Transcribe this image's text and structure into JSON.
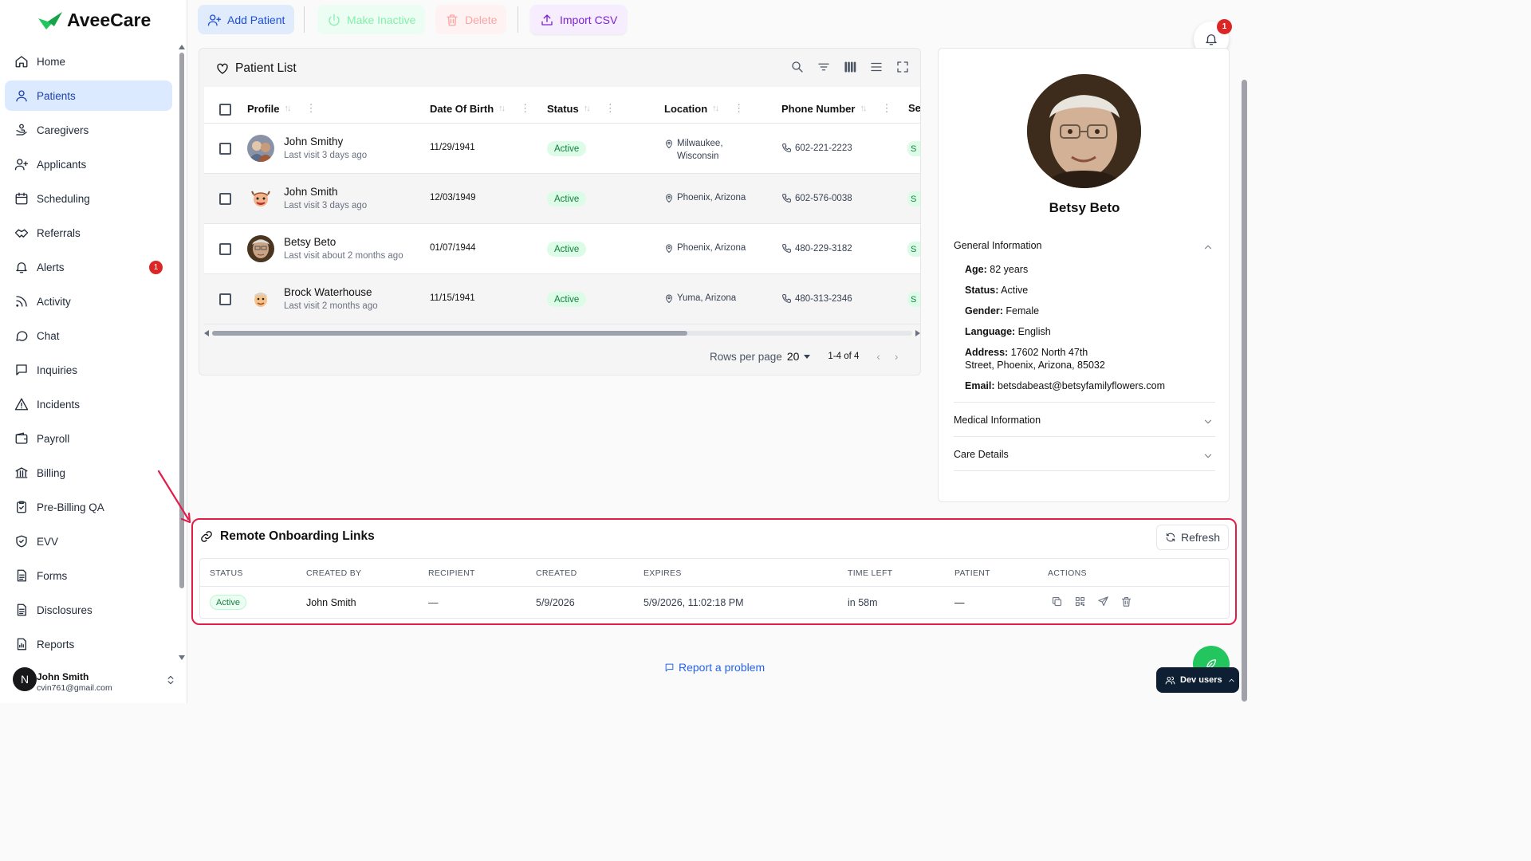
{
  "brand": {
    "name": "AveeCare"
  },
  "sidebar": {
    "items": [
      {
        "label": "Home",
        "icon": "home-icon"
      },
      {
        "label": "Patients",
        "icon": "user-icon",
        "active": true
      },
      {
        "label": "Caregivers",
        "icon": "caregivers-icon"
      },
      {
        "label": "Applicants",
        "icon": "user-plus-icon"
      },
      {
        "label": "Scheduling",
        "icon": "calendar-icon"
      },
      {
        "label": "Referrals",
        "icon": "handshake-icon"
      },
      {
        "label": "Alerts",
        "icon": "bell-icon",
        "badge": "1"
      },
      {
        "label": "Activity",
        "icon": "activity-icon"
      },
      {
        "label": "Chat",
        "icon": "chat-icon"
      },
      {
        "label": "Inquiries",
        "icon": "message-square-icon"
      },
      {
        "label": "Incidents",
        "icon": "warning-icon"
      },
      {
        "label": "Payroll",
        "icon": "wallet-icon"
      },
      {
        "label": "Billing",
        "icon": "bank-icon"
      },
      {
        "label": "Pre-Billing QA",
        "icon": "clipboard-check-icon"
      },
      {
        "label": "EVV",
        "icon": "shield-check-icon"
      },
      {
        "label": "Forms",
        "icon": "file-text-icon"
      },
      {
        "label": "Disclosures",
        "icon": "file-text-icon"
      },
      {
        "label": "Reports",
        "icon": "report-icon"
      }
    ],
    "user": {
      "initial": "N",
      "name": "John Smith",
      "email": "cvin761@gmail.com"
    }
  },
  "toolbar": {
    "add_patient": "Add Patient",
    "make_inactive": "Make Inactive",
    "delete": "Delete",
    "import_csv": "Import CSV"
  },
  "notifications": {
    "count": "1"
  },
  "patient_list": {
    "title": "Patient List",
    "columns": [
      "Profile",
      "Date Of Birth",
      "Status",
      "Location",
      "Phone Number",
      "Se"
    ],
    "rows": [
      {
        "name": "John Smithy",
        "last_visit": "Last visit 3 days ago",
        "dob": "11/29/1941",
        "status": "Active",
        "location_1": "Milwaukee,",
        "location_2": "Wisconsin",
        "phone": "602-221-2223",
        "cut": "S"
      },
      {
        "name": "John Smith",
        "last_visit": "Last visit 3 days ago",
        "dob": "12/03/1949",
        "status": "Active",
        "location_1": "Phoenix, Arizona",
        "location_2": "",
        "phone": "602-576-0038",
        "cut": "S"
      },
      {
        "name": "Betsy Beto",
        "last_visit": "Last visit about 2 months ago",
        "dob": "01/07/1944",
        "status": "Active",
        "location_1": "Phoenix, Arizona",
        "location_2": "",
        "phone": "480-229-3182",
        "cut": "S"
      },
      {
        "name": "Brock Waterhouse",
        "last_visit": "Last visit 2 months ago",
        "dob": "11/15/1941",
        "status": "Active",
        "location_1": "Yuma, Arizona",
        "location_2": "",
        "phone": "480-313-2346",
        "cut": "S"
      }
    ],
    "pagination": {
      "rows_per_page_label": "Rows per page",
      "rows_per_page": "20",
      "range": "1-4 of 4"
    }
  },
  "details": {
    "name": "Betsy Beto",
    "general": {
      "title": "General Information",
      "age_label": "Age:",
      "age": " 82 years",
      "status_label": "Status:",
      "status": " Active",
      "gender_label": "Gender:",
      "gender": " Female",
      "language_label": "Language:",
      "language": " English",
      "address_label": "Address:",
      "address": " 17602 North 47th Street, Phoenix, Arizona, 85032",
      "email_label": "Email:",
      "email": " betsdabeast@betsyfamilyflowers.com"
    },
    "medical_title": "Medical Information",
    "care_title": "Care Details"
  },
  "remote": {
    "title": "Remote Onboarding Links",
    "refresh": "Refresh",
    "columns": [
      "STATUS",
      "CREATED BY",
      "RECIPIENT",
      "CREATED",
      "EXPIRES",
      "TIME LEFT",
      "PATIENT",
      "ACTIONS"
    ],
    "row": {
      "status": "Active",
      "created_by": "John Smith",
      "recipient": "—",
      "created": "5/9/2026",
      "expires": "5/9/2026, 11:02:18 PM",
      "time_left": "in 58m",
      "patient": "—"
    }
  },
  "footer": {
    "report": "Report a problem",
    "dev_users": "Dev users"
  },
  "colors": {
    "primary": "#2563eb",
    "active_nav_bg": "#dbeafe",
    "highlight": "#e11d48",
    "status_green": "#15803d",
    "fab": "#22c55e"
  }
}
